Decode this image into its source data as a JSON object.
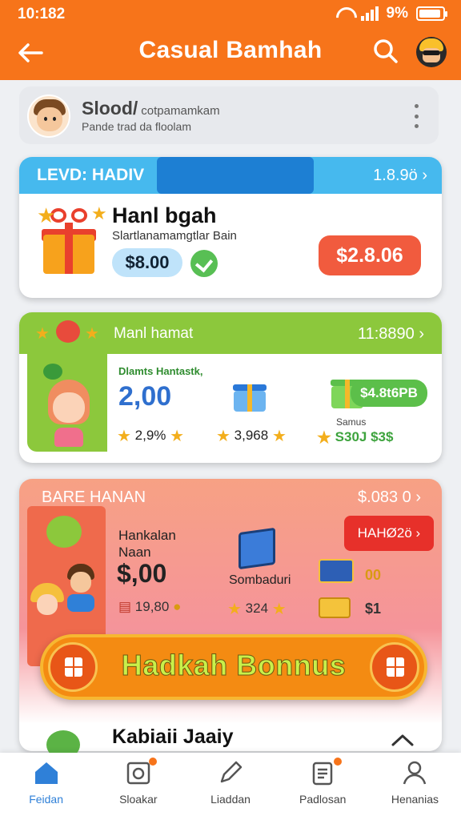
{
  "status": {
    "time": "10:182",
    "battery": "9%"
  },
  "appbar": {
    "title": "Casual Bamhah"
  },
  "profile": {
    "name": "Slood/",
    "name_suffix": "cotpamamkam",
    "subtitle": "Pande trad da floolam"
  },
  "card_blue": {
    "header_label": "LEVD: HADIV",
    "header_value": "1.8.9ö ›",
    "title": "Hanl bgah",
    "description": "Slartlanamamgtlar Bain",
    "price": "$8.00",
    "buy_button": "$2.8.06"
  },
  "card_green": {
    "header_label": "Manl hamat",
    "header_value": "11:8890 ›",
    "promo_label": "Dlamts Hantastk,",
    "big_value": "2,00",
    "stat1": "2,9%",
    "stat2": "3,968",
    "pill": "$4.8t6PB",
    "small_label": "Samus",
    "stat3": "S30J $3$"
  },
  "card_pink": {
    "header_label": "BARE HANAN",
    "header_value": "$.083 0 ›",
    "label_line1": "Hankalan",
    "label_line2": "Naan",
    "amount": "$,00",
    "stat1": "19,80",
    "item_label": "Sombaduri",
    "stat2": "324",
    "red_button": "HAHØ2ö ›",
    "val1": "00",
    "val2": "$1"
  },
  "bonus": {
    "label": "Hadkah Bonnus"
  },
  "next_card": {
    "title": "Kabiaii Jaaiy"
  },
  "nav": [
    {
      "label": "Feidan",
      "icon": "home-icon"
    },
    {
      "label": "Sloakar",
      "icon": "history-icon"
    },
    {
      "label": "Liaddan",
      "icon": "pencil-icon"
    },
    {
      "label": "Padlosan",
      "icon": "clipboard-icon"
    },
    {
      "label": "Henanias",
      "icon": "person-icon"
    }
  ],
  "colors": {
    "primary": "#f7741a",
    "blue": "#46b9ee",
    "green": "#8cc83c",
    "pink": "#f5949a",
    "buy": "#f15b3e"
  }
}
